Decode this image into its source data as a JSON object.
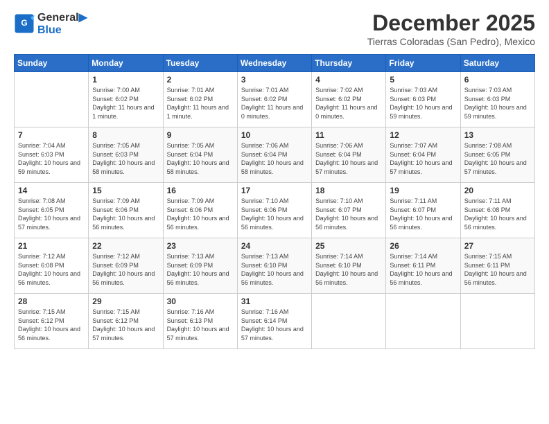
{
  "header": {
    "logo_line1": "General",
    "logo_line2": "Blue",
    "month": "December 2025",
    "location": "Tierras Coloradas (San Pedro), Mexico"
  },
  "days_of_week": [
    "Sunday",
    "Monday",
    "Tuesday",
    "Wednesday",
    "Thursday",
    "Friday",
    "Saturday"
  ],
  "weeks": [
    [
      {
        "day": "",
        "sunrise": "",
        "sunset": "",
        "daylight": ""
      },
      {
        "day": "1",
        "sunrise": "Sunrise: 7:00 AM",
        "sunset": "Sunset: 6:02 PM",
        "daylight": "Daylight: 11 hours and 1 minute."
      },
      {
        "day": "2",
        "sunrise": "Sunrise: 7:01 AM",
        "sunset": "Sunset: 6:02 PM",
        "daylight": "Daylight: 11 hours and 1 minute."
      },
      {
        "day": "3",
        "sunrise": "Sunrise: 7:01 AM",
        "sunset": "Sunset: 6:02 PM",
        "daylight": "Daylight: 11 hours and 0 minutes."
      },
      {
        "day": "4",
        "sunrise": "Sunrise: 7:02 AM",
        "sunset": "Sunset: 6:02 PM",
        "daylight": "Daylight: 11 hours and 0 minutes."
      },
      {
        "day": "5",
        "sunrise": "Sunrise: 7:03 AM",
        "sunset": "Sunset: 6:03 PM",
        "daylight": "Daylight: 10 hours and 59 minutes."
      },
      {
        "day": "6",
        "sunrise": "Sunrise: 7:03 AM",
        "sunset": "Sunset: 6:03 PM",
        "daylight": "Daylight: 10 hours and 59 minutes."
      }
    ],
    [
      {
        "day": "7",
        "sunrise": "Sunrise: 7:04 AM",
        "sunset": "Sunset: 6:03 PM",
        "daylight": "Daylight: 10 hours and 59 minutes."
      },
      {
        "day": "8",
        "sunrise": "Sunrise: 7:05 AM",
        "sunset": "Sunset: 6:03 PM",
        "daylight": "Daylight: 10 hours and 58 minutes."
      },
      {
        "day": "9",
        "sunrise": "Sunrise: 7:05 AM",
        "sunset": "Sunset: 6:04 PM",
        "daylight": "Daylight: 10 hours and 58 minutes."
      },
      {
        "day": "10",
        "sunrise": "Sunrise: 7:06 AM",
        "sunset": "Sunset: 6:04 PM",
        "daylight": "Daylight: 10 hours and 58 minutes."
      },
      {
        "day": "11",
        "sunrise": "Sunrise: 7:06 AM",
        "sunset": "Sunset: 6:04 PM",
        "daylight": "Daylight: 10 hours and 57 minutes."
      },
      {
        "day": "12",
        "sunrise": "Sunrise: 7:07 AM",
        "sunset": "Sunset: 6:04 PM",
        "daylight": "Daylight: 10 hours and 57 minutes."
      },
      {
        "day": "13",
        "sunrise": "Sunrise: 7:08 AM",
        "sunset": "Sunset: 6:05 PM",
        "daylight": "Daylight: 10 hours and 57 minutes."
      }
    ],
    [
      {
        "day": "14",
        "sunrise": "Sunrise: 7:08 AM",
        "sunset": "Sunset: 6:05 PM",
        "daylight": "Daylight: 10 hours and 57 minutes."
      },
      {
        "day": "15",
        "sunrise": "Sunrise: 7:09 AM",
        "sunset": "Sunset: 6:06 PM",
        "daylight": "Daylight: 10 hours and 56 minutes."
      },
      {
        "day": "16",
        "sunrise": "Sunrise: 7:09 AM",
        "sunset": "Sunset: 6:06 PM",
        "daylight": "Daylight: 10 hours and 56 minutes."
      },
      {
        "day": "17",
        "sunrise": "Sunrise: 7:10 AM",
        "sunset": "Sunset: 6:06 PM",
        "daylight": "Daylight: 10 hours and 56 minutes."
      },
      {
        "day": "18",
        "sunrise": "Sunrise: 7:10 AM",
        "sunset": "Sunset: 6:07 PM",
        "daylight": "Daylight: 10 hours and 56 minutes."
      },
      {
        "day": "19",
        "sunrise": "Sunrise: 7:11 AM",
        "sunset": "Sunset: 6:07 PM",
        "daylight": "Daylight: 10 hours and 56 minutes."
      },
      {
        "day": "20",
        "sunrise": "Sunrise: 7:11 AM",
        "sunset": "Sunset: 6:08 PM",
        "daylight": "Daylight: 10 hours and 56 minutes."
      }
    ],
    [
      {
        "day": "21",
        "sunrise": "Sunrise: 7:12 AM",
        "sunset": "Sunset: 6:08 PM",
        "daylight": "Daylight: 10 hours and 56 minutes."
      },
      {
        "day": "22",
        "sunrise": "Sunrise: 7:12 AM",
        "sunset": "Sunset: 6:09 PM",
        "daylight": "Daylight: 10 hours and 56 minutes."
      },
      {
        "day": "23",
        "sunrise": "Sunrise: 7:13 AM",
        "sunset": "Sunset: 6:09 PM",
        "daylight": "Daylight: 10 hours and 56 minutes."
      },
      {
        "day": "24",
        "sunrise": "Sunrise: 7:13 AM",
        "sunset": "Sunset: 6:10 PM",
        "daylight": "Daylight: 10 hours and 56 minutes."
      },
      {
        "day": "25",
        "sunrise": "Sunrise: 7:14 AM",
        "sunset": "Sunset: 6:10 PM",
        "daylight": "Daylight: 10 hours and 56 minutes."
      },
      {
        "day": "26",
        "sunrise": "Sunrise: 7:14 AM",
        "sunset": "Sunset: 6:11 PM",
        "daylight": "Daylight: 10 hours and 56 minutes."
      },
      {
        "day": "27",
        "sunrise": "Sunrise: 7:15 AM",
        "sunset": "Sunset: 6:11 PM",
        "daylight": "Daylight: 10 hours and 56 minutes."
      }
    ],
    [
      {
        "day": "28",
        "sunrise": "Sunrise: 7:15 AM",
        "sunset": "Sunset: 6:12 PM",
        "daylight": "Daylight: 10 hours and 56 minutes."
      },
      {
        "day": "29",
        "sunrise": "Sunrise: 7:15 AM",
        "sunset": "Sunset: 6:12 PM",
        "daylight": "Daylight: 10 hours and 57 minutes."
      },
      {
        "day": "30",
        "sunrise": "Sunrise: 7:16 AM",
        "sunset": "Sunset: 6:13 PM",
        "daylight": "Daylight: 10 hours and 57 minutes."
      },
      {
        "day": "31",
        "sunrise": "Sunrise: 7:16 AM",
        "sunset": "Sunset: 6:14 PM",
        "daylight": "Daylight: 10 hours and 57 minutes."
      },
      {
        "day": "",
        "sunrise": "",
        "sunset": "",
        "daylight": ""
      },
      {
        "day": "",
        "sunrise": "",
        "sunset": "",
        "daylight": ""
      },
      {
        "day": "",
        "sunrise": "",
        "sunset": "",
        "daylight": ""
      }
    ]
  ]
}
